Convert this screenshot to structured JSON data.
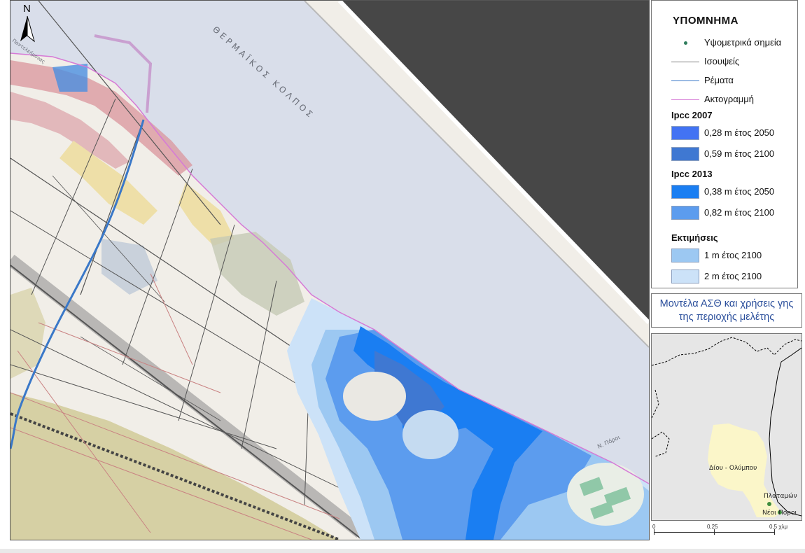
{
  "map": {
    "gulf_label": "ΘΕΡΜΑΪΚΟΣ ΚΟΛΠΟΣ",
    "north_label": "N",
    "road_label": "Ν. Πόροι",
    "corner_label": "Παντελεήμονας",
    "colors": {
      "sea": "#d9deea",
      "gray_background": "#474747",
      "flood_2m": "#cce2f8",
      "flood_1m": "#9cc8f2",
      "flood_082": "#5c9cee",
      "flood_038": "#1a7ef2",
      "flood_059": "#3f78d2",
      "flood_028": "#4273f3",
      "settlement": "#d9949c",
      "yellow_parcels": "#eedfa8",
      "hills": "#d6d0a4"
    }
  },
  "legend": {
    "title": "ΥΠΟΜΝΗΜΑ",
    "items": [
      {
        "label": "Υψομετρικά σημεία",
        "symbol": "point",
        "color": "#2f7d5d"
      },
      {
        "label": "Ισουψείς",
        "symbol": "line",
        "color": "#7d7d7d"
      },
      {
        "label": "Ρέματα",
        "symbol": "line",
        "color": "#3a78c8"
      },
      {
        "label": "Ακτογραμμή",
        "symbol": "line",
        "color": "#d67ad6"
      }
    ],
    "sections": [
      {
        "title": "Ipcc 2007",
        "items": [
          {
            "label": "0,28 m έτος 2050",
            "color": "#4273f3"
          },
          {
            "label": "0,59 m έτος 2100",
            "color": "#3f78d2"
          }
        ]
      },
      {
        "title": "Ipcc 2013",
        "items": [
          {
            "label": "0,38 m έτος 2050",
            "color": "#1a7ef2"
          },
          {
            "label": "0,82 m έτος 2100",
            "color": "#5c9cee"
          }
        ]
      },
      {
        "title": "Εκτιμήσεις",
        "items": [
          {
            "label": "1 m έτος 2100",
            "color": "#9cc8f2"
          },
          {
            "label": "2 m έτος 2100",
            "color": "#cce2f8"
          }
        ]
      }
    ]
  },
  "study_title": "Μοντέλα ΑΣΘ και χρήσεις γης της περιοχής μελέτης",
  "inset": {
    "labels": [
      "Δίου - Ολύμπου",
      "Πλαταμών",
      "Νέοι Πόροι"
    ],
    "colors": {
      "municipality": "#fbf6c9",
      "outside": "#e6e6e6",
      "boundary": "#000000",
      "settlement_point": "#3f8d3f"
    }
  },
  "scalebar": {
    "labels": [
      "0",
      "0,25",
      "0,5 χλμ"
    ]
  }
}
